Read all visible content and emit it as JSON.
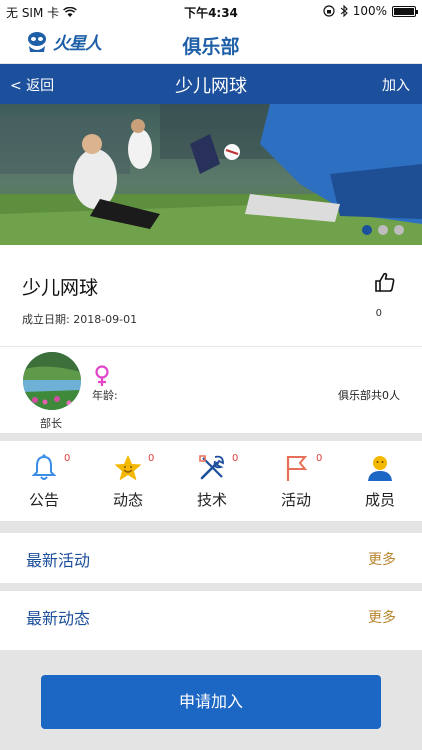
{
  "status_bar": {
    "carrier": "无 SIM 卡",
    "time": "下午4:34",
    "battery": "100%",
    "battery_level": 1.0
  },
  "app_header": {
    "logo_text": "火星人",
    "title": "俱乐部"
  },
  "nav": {
    "back_label": "< 返回",
    "title": "少儿网球",
    "join_label": "加入"
  },
  "banner": {
    "slide_count": 3,
    "active_slide": 1
  },
  "club": {
    "name": "少儿网球",
    "founded_label": "成立日期:",
    "founded_date": "2018-09-01",
    "like_count": "0"
  },
  "leader": {
    "role_label": "部长",
    "gender_symbol": "♀",
    "age_label": "年龄:",
    "members_summary": "俱乐部共0人"
  },
  "menu": [
    {
      "label": "公告",
      "badge": "0",
      "icon": "bell-icon",
      "color": "#3a8ee6"
    },
    {
      "label": "动态",
      "badge": "0",
      "icon": "star-icon",
      "color": "#f5b800"
    },
    {
      "label": "技术",
      "badge": "0",
      "icon": "tools-icon",
      "color": "#1c4f9c"
    },
    {
      "label": "活动",
      "badge": "0",
      "icon": "flag-icon",
      "color": "#e8705a"
    },
    {
      "label": "成员",
      "badge": "",
      "icon": "member-icon",
      "color": "#f5b800"
    }
  ],
  "sections": [
    {
      "title": "最新活动",
      "more": "更多"
    },
    {
      "title": "最新动态",
      "more": "更多"
    }
  ],
  "apply_button": "申请加入",
  "colors": {
    "brand_blue": "#1c4f9c",
    "button_blue": "#1c66c4",
    "more_gold": "#b8862d",
    "badge_red": "#e04040"
  }
}
